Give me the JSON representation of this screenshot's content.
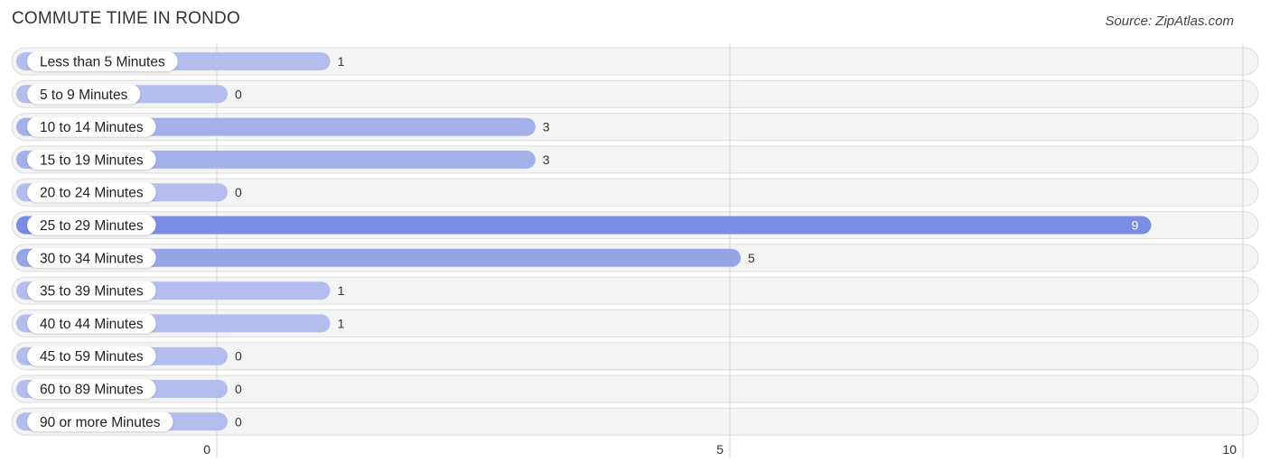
{
  "chart_data": {
    "type": "bar",
    "orientation": "horizontal",
    "title": "COMMUTE TIME IN RONDO",
    "source": "Source: ZipAtlas.com",
    "categories": [
      "Less than 5 Minutes",
      "5 to 9 Minutes",
      "10 to 14 Minutes",
      "15 to 19 Minutes",
      "20 to 24 Minutes",
      "25 to 29 Minutes",
      "30 to 34 Minutes",
      "35 to 39 Minutes",
      "40 to 44 Minutes",
      "45 to 59 Minutes",
      "60 to 89 Minutes",
      "90 or more Minutes"
    ],
    "values": [
      1,
      0,
      3,
      3,
      0,
      9,
      5,
      1,
      1,
      0,
      0,
      0
    ],
    "xlabel": "",
    "ylabel": "",
    "xlim": [
      0,
      10
    ],
    "xticks": [
      0,
      5,
      10
    ],
    "xtick_labels": [
      "0",
      "5",
      "10"
    ],
    "grid": true,
    "legend": "none",
    "colors": {
      "bar_max": "#7b8de0",
      "bar_high": "#97a5e6",
      "bar_mid": "#a3b0ea",
      "bar_low": "#b3bdee",
      "track": "#f4f4f4"
    }
  }
}
